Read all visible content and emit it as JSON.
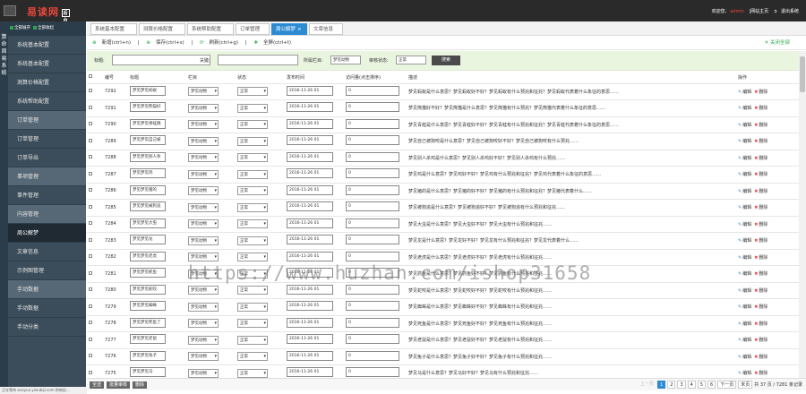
{
  "header": {
    "logo_text": "易读网",
    "logo_tag": "后台",
    "welcome": "欢迎您,",
    "user": "admin",
    "site_home": "|网站主页",
    "logout": "退出系统"
  },
  "side_strip": "算命周易系统",
  "sidebar": {
    "top": [
      "全部展开",
      "全部收起"
    ],
    "items": [
      {
        "label": "系统基本配置",
        "section": false,
        "active": false
      },
      {
        "label": "系统基本配置",
        "section": false,
        "active": false
      },
      {
        "label": "测算价格配置",
        "section": false,
        "active": false
      },
      {
        "label": "系统帮助配置",
        "section": false,
        "active": false
      },
      {
        "label": "订单管理",
        "section": true,
        "active": false
      },
      {
        "label": "订单管理",
        "section": false,
        "active": false
      },
      {
        "label": "订单导出",
        "section": false,
        "active": false
      },
      {
        "label": "事项管理",
        "section": true,
        "active": false
      },
      {
        "label": "事件管理",
        "section": false,
        "active": false
      },
      {
        "label": "内容管理",
        "section": true,
        "active": false
      },
      {
        "label": "周公解梦",
        "section": false,
        "active": true
      },
      {
        "label": "文章信息",
        "section": false,
        "active": false
      },
      {
        "label": "示例图管理",
        "section": false,
        "active": false
      },
      {
        "label": "手动数据",
        "section": true,
        "active": false
      },
      {
        "label": "手动数据",
        "section": false,
        "active": false
      },
      {
        "label": "手动分类",
        "section": false,
        "active": false
      }
    ]
  },
  "tabs": [
    {
      "label": "系统基本配置",
      "active": false
    },
    {
      "label": "测算价格配置",
      "active": false
    },
    {
      "label": "系统帮助配置",
      "active": false
    },
    {
      "label": "订单管理",
      "active": false
    },
    {
      "label": "周公解梦",
      "active": true
    },
    {
      "label": "文章信息",
      "active": false
    }
  ],
  "actions": {
    "add": "新增(ctrl+n)",
    "delete": "保存(ctrl+s)",
    "refresh": "刷新(ctrl+g)",
    "all": "全屏(ctrl+t)",
    "close_all": "关闭全部"
  },
  "filters": {
    "field1_label": "标题:",
    "field2_label": "关键:",
    "cat_label": "所属栏目:",
    "cat_value": "梦见动物",
    "status_label": "审核状态:",
    "status_value": "正常",
    "search_btn": "搜索"
  },
  "table": {
    "headers": [
      "",
      "编号",
      "标题",
      "栏目",
      "状态",
      "发布时间",
      "访问量(点击排序)",
      "描述",
      "操作"
    ],
    "edit_label": "编辑",
    "del_label": "删除",
    "rows": [
      {
        "id": "7292",
        "title": "梦见梦见蚂蚁",
        "cat": "梦见动物",
        "status": "正常",
        "date": "2016-11-26 01",
        "views": "0",
        "desc": "梦见蚂蚁是什么意思？梦见蚂蚁好不好？梦见蚂蚁有什么预兆和征兆？梦见蚂蚁代表着什么象征的意思……"
      },
      {
        "id": "7291",
        "title": "梦见梦见熊猫好",
        "cat": "梦见动物",
        "status": "正常",
        "date": "2016-11-26 01",
        "views": "0",
        "desc": "梦见熊猫好不好？梦见熊猫是什么意思？梦见熊猫有什么预兆？梦见熊猫代表着什么象征的意思……"
      },
      {
        "id": "7290",
        "title": "梦见梦见青蛙跳",
        "cat": "梦见动物",
        "status": "正常",
        "date": "2016-11-26 01",
        "views": "0",
        "desc": "梦见青蛙是什么意思？梦见青蛙好不好？梦见青蛙有什么预兆和征兆？梦见青蛙代表着什么象征的意思……"
      },
      {
        "id": "7289",
        "title": "梦见梦见自己被",
        "cat": "梦见动物",
        "status": "正常",
        "date": "2016-11-26 01",
        "views": "0",
        "desc": "梦见自己被狗咬是什么意思？梦见自己被狗咬好不好？梦见自己被狗咬有什么预兆……"
      },
      {
        "id": "7288",
        "title": "梦见梦见别人杀",
        "cat": "梦见动物",
        "status": "正常",
        "date": "2016-11-26 01",
        "views": "0",
        "desc": "梦见别人杀鸡是什么意思？梦见别人杀鸡好不好？梦见别人杀鸡有什么预兆……"
      },
      {
        "id": "7287",
        "title": "梦见梦见鸡",
        "cat": "梦见动物",
        "status": "正常",
        "date": "2016-11-26 01",
        "views": "0",
        "desc": "梦见鸡是什么意思？梦见鸡好不好？梦见鸡有什么预兆和征兆？梦见鸡代表着什么象征的意思……"
      },
      {
        "id": "7286",
        "title": "梦见梦见猪的",
        "cat": "梦见动物",
        "status": "正常",
        "date": "2016-11-26 01",
        "views": "0",
        "desc": "梦见猪的是什么意思？梦见猪的好不好？梦见猪的有什么预兆和征兆？梦见猪代表着什么……"
      },
      {
        "id": "7285",
        "title": "梦见梦见被狗追",
        "cat": "梦见动物",
        "status": "正常",
        "date": "2016-11-26 01",
        "views": "0",
        "desc": "梦见被狗追是什么意思？梦见被狗追好不好？梦见被狗追有什么预兆和征兆……"
      },
      {
        "id": "7284",
        "title": "梦见梦见大虫",
        "cat": "梦见动物",
        "status": "正常",
        "date": "2016-11-26 01",
        "views": "0",
        "desc": "梦见大虫是什么意思？梦见大虫好不好？梦见大虫有什么预兆和征兆……"
      },
      {
        "id": "7283",
        "title": "梦见梦见龙",
        "cat": "梦见动物",
        "status": "正常",
        "date": "2016-11-26 01",
        "views": "0",
        "desc": "梦见龙是什么意思？梦见龙好不好？梦见龙有什么预兆和征兆？梦见龙代表着什么……"
      },
      {
        "id": "7282",
        "title": "梦见梦见老虎",
        "cat": "梦见动物",
        "status": "正常",
        "date": "2016-11-26 01",
        "views": "0",
        "desc": "梦见老虎是什么意思？梦见老虎好不好？梦见老虎有什么预兆和征兆……"
      },
      {
        "id": "7281",
        "title": "梦见梦见抓鱼",
        "cat": "梦见动物",
        "status": "正常",
        "date": "2016-11-26 01",
        "views": "0",
        "desc": "梦见抓鱼是什么意思？梦见抓鱼好不好？梦见抓鱼有什么预兆和征兆……"
      },
      {
        "id": "7280",
        "title": "梦见梦见蛇咬",
        "cat": "梦见动物",
        "status": "正常",
        "date": "2016-11-26 01",
        "views": "0",
        "desc": "梦见蛇咬是什么意思？梦见蛇咬好不好？梦见蛇咬有什么预兆和征兆……"
      },
      {
        "id": "7279",
        "title": "梦见梦见蜘蛛",
        "cat": "梦见动物",
        "status": "正常",
        "date": "2016-11-26 01",
        "views": "0",
        "desc": "梦见蜘蛛是什么意思？梦见蜘蛛好不好？梦见蜘蛛有什么预兆和征兆……"
      },
      {
        "id": "7278",
        "title": "梦见梦见死鱼了",
        "cat": "梦见动物",
        "status": "正常",
        "date": "2016-11-26 01",
        "views": "0",
        "desc": "梦见死鱼是什么意思？梦见死鱼好不好？梦见死鱼有什么预兆和征兆……"
      },
      {
        "id": "7277",
        "title": "梦见梦见老鼠",
        "cat": "梦见动物",
        "status": "正常",
        "date": "2016-11-26 01",
        "views": "0",
        "desc": "梦见老鼠是什么意思？梦见老鼠好不好？梦见老鼠有什么预兆和征兆……"
      },
      {
        "id": "7276",
        "title": "梦见梦见兔子",
        "cat": "梦见动物",
        "status": "正常",
        "date": "2016-11-26 01",
        "views": "0",
        "desc": "梦见兔子是什么意思？梦见兔子好不好？梦见兔子有什么预兆和征兆……"
      },
      {
        "id": "7275",
        "title": "梦见梦见马",
        "cat": "梦见动物",
        "status": "正常",
        "date": "2016-11-26 01",
        "views": "0",
        "desc": "梦见马是什么意思？梦见马好不好？梦见马有什么预兆和征兆……"
      },
      {
        "id": "7274",
        "title": "梦见梦见羊",
        "cat": "梦见动物",
        "status": "正常",
        "date": "2016-11-26 01",
        "views": "0",
        "desc": "梦见羊是什么意思？梦见羊好不好？梦见羊有什么预兆和征兆……"
      }
    ]
  },
  "bottom": {
    "buttons": [
      "全选",
      "批量审核",
      "删除"
    ],
    "prev": "上一页",
    "pages": [
      "1",
      "2",
      "3",
      "4",
      "5",
      "6"
    ],
    "next": "下一页",
    "last": "末页",
    "total": "共 37 页 / 7281 条记录",
    "current": "1"
  },
  "statusbar": "正在等待 anayun.yixiubiji.com 的响应...",
  "watermark": "https://www.huzhan.com/ishop31658"
}
